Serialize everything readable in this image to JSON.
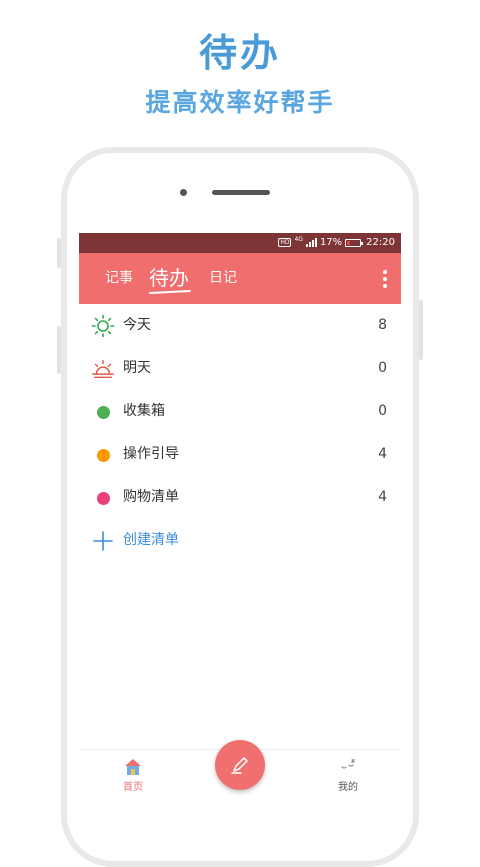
{
  "promo": {
    "headline": "待办",
    "subline": "提高效率好帮手"
  },
  "statusbar": {
    "network_badge": "HD",
    "network_type": "4G",
    "battery": "17%",
    "time": "22:20"
  },
  "toolbar": {
    "tabs": [
      {
        "label": "记事"
      },
      {
        "label": "待办"
      },
      {
        "label": "日记"
      }
    ],
    "more_icon": "more-vertical-icon"
  },
  "lists": [
    {
      "label": "今天",
      "count": "8",
      "icon": "sun-icon",
      "color": "#2fa84f"
    },
    {
      "label": "明天",
      "count": "0",
      "icon": "sunrise-icon",
      "color": "#e05a4a"
    },
    {
      "label": "收集箱",
      "count": "0",
      "icon": "dot-icon",
      "color": "#4caf50"
    },
    {
      "label": "操作引导",
      "count": "4",
      "icon": "dot-icon",
      "color": "#ff9800"
    },
    {
      "label": "购物清单",
      "count": "4",
      "icon": "dot-icon",
      "color": "#ec407a"
    }
  ],
  "create": {
    "label": "创建清单",
    "icon": "plus-icon"
  },
  "bottom_nav": {
    "home_label": "首页",
    "mine_label": "我的",
    "fab_icon": "pencil-icon"
  },
  "colors": {
    "accent": "#f06e6e",
    "statusbar": "#7d3434",
    "headline": "#4a9ad8",
    "link": "#3a8ed8"
  }
}
